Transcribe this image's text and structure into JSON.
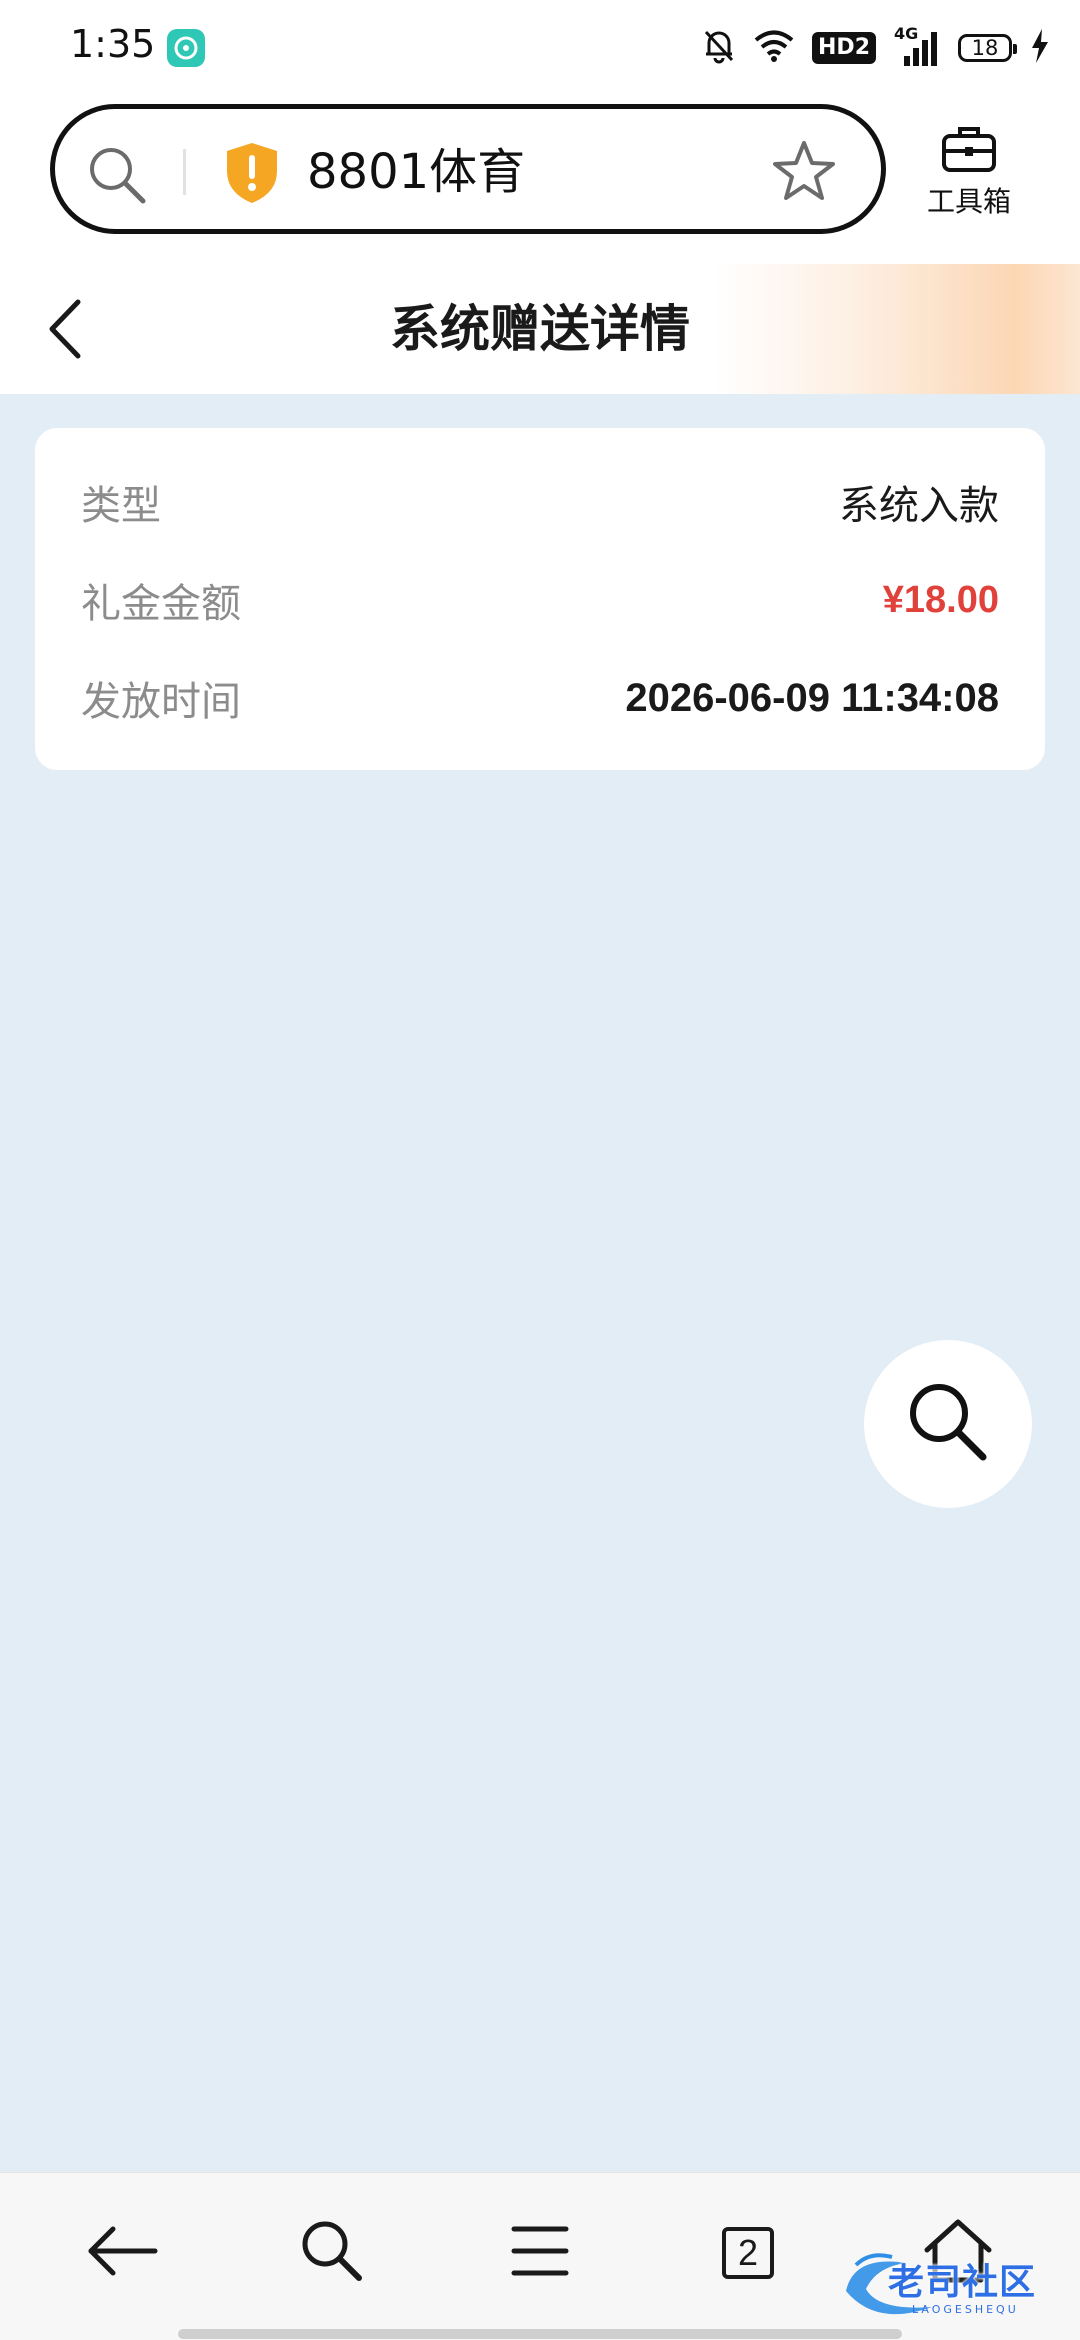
{
  "status_bar": {
    "time": "1:35",
    "network": "4G",
    "hd_label": "HD2",
    "battery": "18"
  },
  "address_bar": {
    "url_text": "8801体育",
    "toolbox_label": "工具箱"
  },
  "header": {
    "title": "系统赠送详情"
  },
  "details": {
    "rows": [
      {
        "label": "类型",
        "value": "系统入款"
      },
      {
        "label": "礼金金额",
        "value": "¥18.00"
      },
      {
        "label": "发放时间",
        "value": "2026-06-09 11:34:08"
      }
    ]
  },
  "bottom_nav": {
    "tab_count": "2"
  },
  "watermark": {
    "text": "老司社区",
    "subtext": "LAOGESHEQU"
  },
  "colors": {
    "page_background": "#e3edf6",
    "amount_red": "#e0413b",
    "shield_orange": "#f5a623",
    "status_app_teal": "#2fc7b5"
  }
}
